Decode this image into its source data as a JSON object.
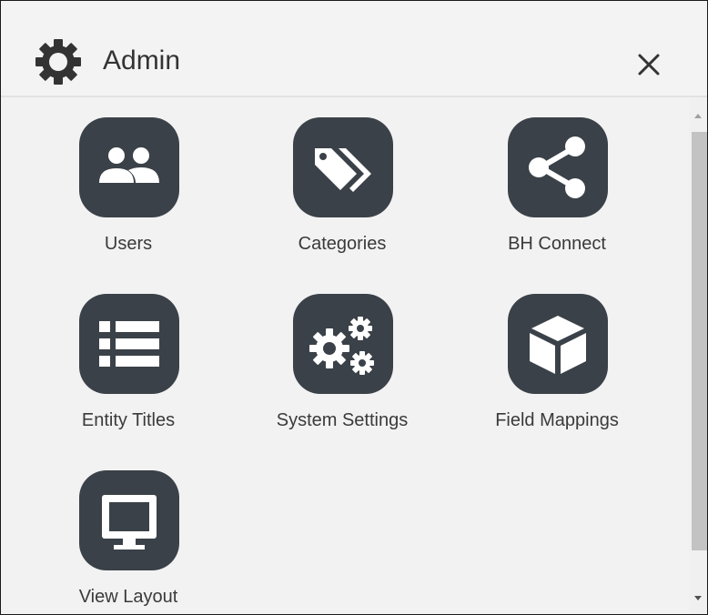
{
  "header": {
    "title": "Admin",
    "icon": "gear-icon",
    "close_icon": "close-icon"
  },
  "tiles": [
    {
      "label": "Users",
      "icon": "users-icon"
    },
    {
      "label": "Categories",
      "icon": "tags-icon"
    },
    {
      "label": "BH Connect",
      "icon": "share-icon"
    },
    {
      "label": "Entity Titles",
      "icon": "list-icon"
    },
    {
      "label": "System Settings",
      "icon": "gears-icon"
    },
    {
      "label": "Field Mappings",
      "icon": "cube-icon"
    },
    {
      "label": "View Layout",
      "icon": "monitor-icon"
    }
  ],
  "colors": {
    "tile_bg": "#3b4148",
    "panel_bg": "#f2f2f2",
    "text": "#333333"
  }
}
